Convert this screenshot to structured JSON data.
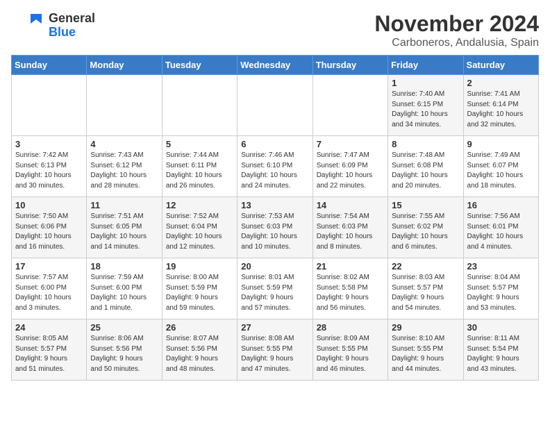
{
  "header": {
    "logo_line1": "General",
    "logo_line2": "Blue",
    "month": "November 2024",
    "location": "Carboneros, Andalusia, Spain"
  },
  "weekdays": [
    "Sunday",
    "Monday",
    "Tuesday",
    "Wednesday",
    "Thursday",
    "Friday",
    "Saturday"
  ],
  "weeks": [
    [
      {
        "day": "",
        "info": ""
      },
      {
        "day": "",
        "info": ""
      },
      {
        "day": "",
        "info": ""
      },
      {
        "day": "",
        "info": ""
      },
      {
        "day": "",
        "info": ""
      },
      {
        "day": "1",
        "info": "Sunrise: 7:40 AM\nSunset: 6:15 PM\nDaylight: 10 hours\nand 34 minutes."
      },
      {
        "day": "2",
        "info": "Sunrise: 7:41 AM\nSunset: 6:14 PM\nDaylight: 10 hours\nand 32 minutes."
      }
    ],
    [
      {
        "day": "3",
        "info": "Sunrise: 7:42 AM\nSunset: 6:13 PM\nDaylight: 10 hours\nand 30 minutes."
      },
      {
        "day": "4",
        "info": "Sunrise: 7:43 AM\nSunset: 6:12 PM\nDaylight: 10 hours\nand 28 minutes."
      },
      {
        "day": "5",
        "info": "Sunrise: 7:44 AM\nSunset: 6:11 PM\nDaylight: 10 hours\nand 26 minutes."
      },
      {
        "day": "6",
        "info": "Sunrise: 7:46 AM\nSunset: 6:10 PM\nDaylight: 10 hours\nand 24 minutes."
      },
      {
        "day": "7",
        "info": "Sunrise: 7:47 AM\nSunset: 6:09 PM\nDaylight: 10 hours\nand 22 minutes."
      },
      {
        "day": "8",
        "info": "Sunrise: 7:48 AM\nSunset: 6:08 PM\nDaylight: 10 hours\nand 20 minutes."
      },
      {
        "day": "9",
        "info": "Sunrise: 7:49 AM\nSunset: 6:07 PM\nDaylight: 10 hours\nand 18 minutes."
      }
    ],
    [
      {
        "day": "10",
        "info": "Sunrise: 7:50 AM\nSunset: 6:06 PM\nDaylight: 10 hours\nand 16 minutes."
      },
      {
        "day": "11",
        "info": "Sunrise: 7:51 AM\nSunset: 6:05 PM\nDaylight: 10 hours\nand 14 minutes."
      },
      {
        "day": "12",
        "info": "Sunrise: 7:52 AM\nSunset: 6:04 PM\nDaylight: 10 hours\nand 12 minutes."
      },
      {
        "day": "13",
        "info": "Sunrise: 7:53 AM\nSunset: 6:03 PM\nDaylight: 10 hours\nand 10 minutes."
      },
      {
        "day": "14",
        "info": "Sunrise: 7:54 AM\nSunset: 6:03 PM\nDaylight: 10 hours\nand 8 minutes."
      },
      {
        "day": "15",
        "info": "Sunrise: 7:55 AM\nSunset: 6:02 PM\nDaylight: 10 hours\nand 6 minutes."
      },
      {
        "day": "16",
        "info": "Sunrise: 7:56 AM\nSunset: 6:01 PM\nDaylight: 10 hours\nand 4 minutes."
      }
    ],
    [
      {
        "day": "17",
        "info": "Sunrise: 7:57 AM\nSunset: 6:00 PM\nDaylight: 10 hours\nand 3 minutes."
      },
      {
        "day": "18",
        "info": "Sunrise: 7:59 AM\nSunset: 6:00 PM\nDaylight: 10 hours\nand 1 minute."
      },
      {
        "day": "19",
        "info": "Sunrise: 8:00 AM\nSunset: 5:59 PM\nDaylight: 9 hours\nand 59 minutes."
      },
      {
        "day": "20",
        "info": "Sunrise: 8:01 AM\nSunset: 5:59 PM\nDaylight: 9 hours\nand 57 minutes."
      },
      {
        "day": "21",
        "info": "Sunrise: 8:02 AM\nSunset: 5:58 PM\nDaylight: 9 hours\nand 56 minutes."
      },
      {
        "day": "22",
        "info": "Sunrise: 8:03 AM\nSunset: 5:57 PM\nDaylight: 9 hours\nand 54 minutes."
      },
      {
        "day": "23",
        "info": "Sunrise: 8:04 AM\nSunset: 5:57 PM\nDaylight: 9 hours\nand 53 minutes."
      }
    ],
    [
      {
        "day": "24",
        "info": "Sunrise: 8:05 AM\nSunset: 5:57 PM\nDaylight: 9 hours\nand 51 minutes."
      },
      {
        "day": "25",
        "info": "Sunrise: 8:06 AM\nSunset: 5:56 PM\nDaylight: 9 hours\nand 50 minutes."
      },
      {
        "day": "26",
        "info": "Sunrise: 8:07 AM\nSunset: 5:56 PM\nDaylight: 9 hours\nand 48 minutes."
      },
      {
        "day": "27",
        "info": "Sunrise: 8:08 AM\nSunset: 5:55 PM\nDaylight: 9 hours\nand 47 minutes."
      },
      {
        "day": "28",
        "info": "Sunrise: 8:09 AM\nSunset: 5:55 PM\nDaylight: 9 hours\nand 46 minutes."
      },
      {
        "day": "29",
        "info": "Sunrise: 8:10 AM\nSunset: 5:55 PM\nDaylight: 9 hours\nand 44 minutes."
      },
      {
        "day": "30",
        "info": "Sunrise: 8:11 AM\nSunset: 5:54 PM\nDaylight: 9 hours\nand 43 minutes."
      }
    ]
  ]
}
